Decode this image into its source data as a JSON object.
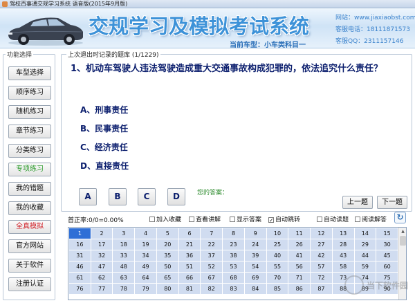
{
  "window": {
    "title": "驾校百事通交规学习系统 语音版(2015年9月版)"
  },
  "banner": {
    "app_title": "交规学习及模拟考试系统",
    "car_type": "当前车型：小车类科目一",
    "website": "网站：www.jiaxiaobst.com",
    "phone": "客服电话：18111871573",
    "qq": "客服QQ：2311157146"
  },
  "sidebar": {
    "legend": "功能选择",
    "items": [
      {
        "label": "车型选择",
        "style": "normal"
      },
      {
        "label": "顺序练习",
        "style": "normal"
      },
      {
        "label": "随机练习",
        "style": "normal"
      },
      {
        "label": "章节练习",
        "style": "normal"
      },
      {
        "label": "分类练习",
        "style": "normal"
      },
      {
        "label": "专项练习",
        "style": "green"
      },
      {
        "label": "我的错题",
        "style": "normal"
      },
      {
        "label": "我的收藏",
        "style": "normal"
      },
      {
        "label": "全真模拟",
        "style": "red"
      },
      {
        "label": "官方网站",
        "style": "normal"
      },
      {
        "label": "关于软件",
        "style": "normal"
      },
      {
        "label": "注册认证",
        "style": "normal"
      }
    ]
  },
  "question_panel": {
    "legend": "上次退出时记录的题库 (1/1229)",
    "question": "1、机动车驾驶人违法驾驶造成重大交通事故构成犯罪的，依法追究什么责任？",
    "options": [
      "A、刑事责任",
      "B、民事责任",
      "C、经济责任",
      "D、直接责任"
    ],
    "answer_buttons": [
      "A",
      "B",
      "C",
      "D"
    ],
    "your_answer_label": "您的答案：",
    "prev_label": "上一题",
    "next_label": "下一题"
  },
  "toolbar": {
    "accuracy": "首正率:0/0=0.00%",
    "checkboxes": [
      {
        "label": "加入收藏",
        "checked": false
      },
      {
        "label": "查看讲解",
        "checked": false
      },
      {
        "label": "显示答案",
        "checked": false
      },
      {
        "label": "自动跳转",
        "checked": true
      },
      {
        "label": "自动读题",
        "checked": false
      },
      {
        "label": "阅读解答",
        "checked": false
      }
    ]
  },
  "question_grid": {
    "columns": 15,
    "visible_numbers": [
      1,
      2,
      3,
      4,
      5,
      6,
      7,
      8,
      9,
      10,
      11,
      12,
      13,
      14,
      15,
      16,
      17,
      18,
      19,
      20,
      21,
      22,
      23,
      24,
      25,
      26,
      27,
      28,
      29,
      30,
      31,
      32,
      33,
      34,
      35,
      36,
      37,
      38,
      39,
      40,
      41,
      42,
      43,
      44,
      45,
      46,
      47,
      48,
      49,
      50,
      51,
      52,
      53,
      54,
      55,
      56,
      57,
      58,
      59,
      60,
      61,
      62,
      63,
      64,
      65,
      66,
      67,
      68,
      69,
      70,
      71,
      72,
      73,
      74,
      75,
      76,
      77,
      78,
      79,
      80,
      81,
      82,
      83,
      84,
      85,
      86,
      87,
      88,
      89,
      90
    ],
    "selected": 1
  },
  "watermark": {
    "text": "当下软件园"
  }
}
